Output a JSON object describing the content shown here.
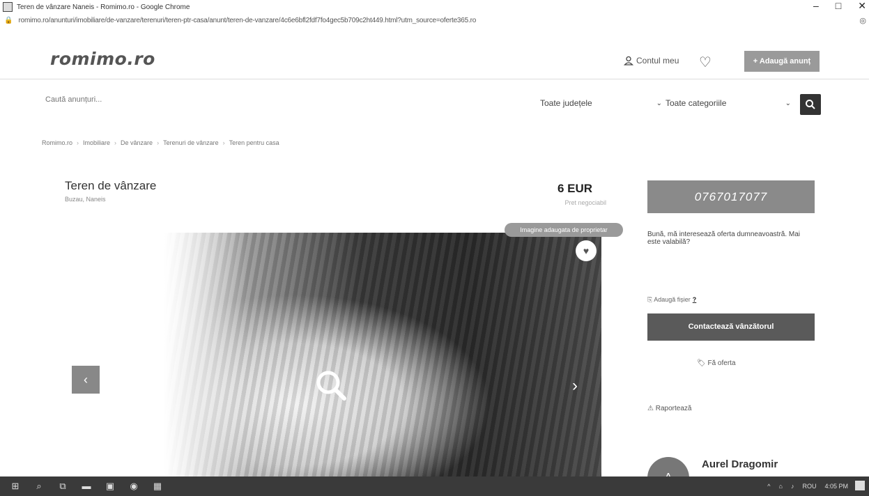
{
  "window": {
    "title": "Teren de vânzare Naneis - Romimo.ro - Google Chrome",
    "controls": [
      "–",
      "□",
      "✕"
    ]
  },
  "address": {
    "url": "romimo.ro/anunturi/imobiliare/de-vanzare/terenuri/teren-ptr-casa/anunt/teren-de-vanzare/4c6e6bfl2fdf7fo4gec5b709c2ht449.html?utm_source=oferte365.ro"
  },
  "header": {
    "logo": "romimo.ro",
    "account_label": "Contul meu",
    "post_button": "+ Adaugă anunț"
  },
  "search": {
    "placeholder": "Caută anunțuri...",
    "county": "Toate județele",
    "category": "Toate categoriile"
  },
  "breadcrumb": [
    "Romimo.ro",
    "Imobiliare",
    "De vânzare",
    "Terenuri de vânzare",
    "Teren pentru casa"
  ],
  "listing": {
    "title": "Teren de vânzare",
    "location": "Buzau, Naneis",
    "price": "6 EUR",
    "price_note": "Pret negociabil",
    "badge": "Imagine adaugata de proprietar"
  },
  "sidebar": {
    "phone": "0767017077",
    "message": "Bună, mă interesează oferta dumneavoastră. Mai este valabilă?",
    "attach_label": "Adaugă fișier",
    "attach_help": "?",
    "contact_button": "Contactează vânzătorul",
    "offer_label": "Fă oferta",
    "report_label": "Raportează",
    "seller_initial": "A",
    "seller_name": "Aurel Dragomir"
  },
  "taskbar": {
    "language": "ROU",
    "time": "4:05 PM"
  }
}
